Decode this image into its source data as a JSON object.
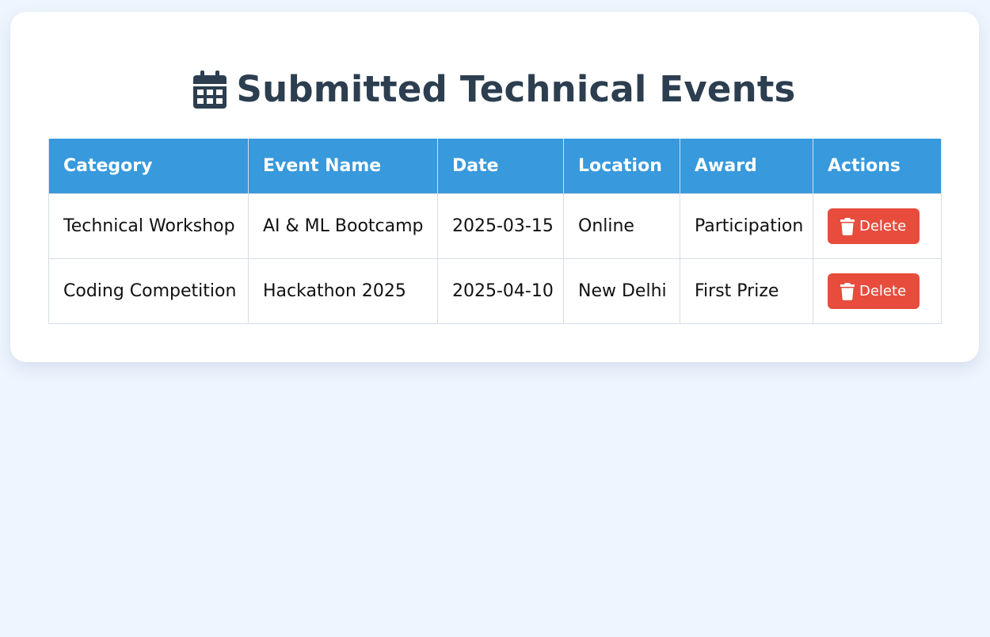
{
  "page": {
    "title": "Submitted Technical Events",
    "title_icon": "calendar-icon"
  },
  "table": {
    "headers": [
      "Category",
      "Event Name",
      "Date",
      "Location",
      "Award",
      "Actions"
    ],
    "rows": [
      {
        "category": "Technical Workshop",
        "event_name": "AI & ML Bootcamp",
        "date": "2025-03-15",
        "location": "Online",
        "award": "Participation",
        "action_label": "Delete"
      },
      {
        "category": "Coding Competition",
        "event_name": "Hackathon 2025",
        "date": "2025-04-10",
        "location": "New Delhi",
        "award": "First Prize",
        "action_label": "Delete"
      }
    ],
    "delete_icon": "trash-icon"
  },
  "colors": {
    "background": "#eef5fe",
    "card": "#ffffff",
    "title": "#2c3e50",
    "header": "#3899dc",
    "delete_button": "#e74c3c"
  }
}
